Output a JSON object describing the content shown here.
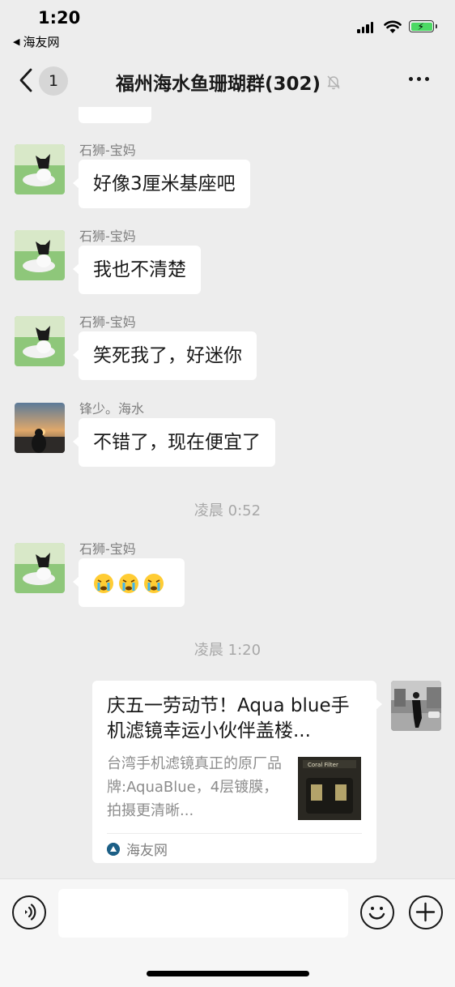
{
  "status_bar": {
    "time": "1:20",
    "back_app": "海友网",
    "back_arrow": "◀"
  },
  "nav": {
    "unread_count": "1",
    "title": "福州海水鱼珊瑚群(302)"
  },
  "messages": [
    {
      "sender": "石狮-宝妈",
      "text": "好像3厘米基座吧"
    },
    {
      "sender": "石狮-宝妈",
      "text": "我也不清楚"
    },
    {
      "sender": "石狮-宝妈",
      "text": "笑死我了，好迷你"
    },
    {
      "sender": "锋少。海水",
      "text": "不错了，现在便宜了"
    },
    {
      "sender": "石狮-宝妈",
      "text": ""
    }
  ],
  "timestamps": [
    "凌晨 0:52",
    "凌晨 1:20"
  ],
  "link_card": {
    "title": "庆五一劳动节！Aqua blue手机滤镜幸运小伙伴盖楼...",
    "description": "台湾手机滤镜真正的原厂品牌:AquaBlue，4层镀膜，拍摄更清晰...",
    "thumb_label": "Coral Filter",
    "source": "海友网"
  },
  "icons": {
    "back": "chevron-left-icon",
    "mute": "bell-off-icon",
    "more": "more-icon",
    "voice": "voice-icon",
    "emoji": "smiley-icon",
    "plus": "plus-icon",
    "crying": "crying-emoji-icon"
  },
  "colors": {
    "background": "#ededed",
    "bubble": "#ffffff",
    "battery": "#4cd964",
    "timestamp": "#a8a8a8"
  }
}
